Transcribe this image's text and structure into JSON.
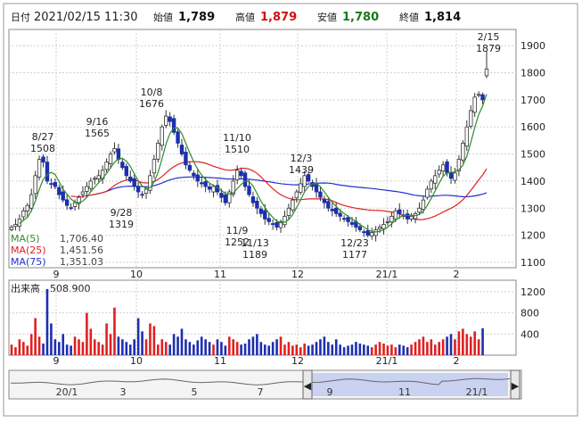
{
  "header": {
    "period_label": "日付",
    "datetime": "2021/02/15 11:30",
    "open_label": "始値",
    "open_value": "1,789",
    "high_label": "高値",
    "high_value": "1,879",
    "low_label": "安値",
    "low_value": "1,780",
    "close_label": "終値",
    "close_value": "1,814"
  },
  "legend": [
    {
      "label": "MA(5)",
      "value": "1,706.40",
      "color": "#2e8b2e"
    },
    {
      "label": "MA(25)",
      "value": "1,451.56",
      "color": "#e02020"
    },
    {
      "label": "MA(75)",
      "value": "1,351.03",
      "color": "#2030d0"
    }
  ],
  "volume_header": {
    "label": "出来高",
    "value": "508.900"
  },
  "colors": {
    "up": "#e02020",
    "down": "#1c2fb0",
    "ma5": "#2e8b2e",
    "ma25": "#e02020",
    "ma75": "#2030d0",
    "grid": "#cfcfcf"
  },
  "chart_data": [
    {
      "type": "candlestick",
      "ylim": [
        1080,
        1960
      ],
      "y_ticks": [
        "1100",
        "1200",
        "1300",
        "1400",
        "1500",
        "1600",
        "1700",
        "1800",
        "1900"
      ],
      "x_ticks": [
        "9",
        "10",
        "11",
        "12",
        "21/1",
        "2"
      ],
      "annotations": [
        {
          "date": "8/27",
          "value": "1508"
        },
        {
          "date": "9/16",
          "value": "1565"
        },
        {
          "date": "9/28",
          "value": "1319"
        },
        {
          "date": "10/8",
          "value": "1676"
        },
        {
          "date": "11/10",
          "value": "1510"
        },
        {
          "date": "11/9",
          "value": "1252"
        },
        {
          "date": "11/13",
          "value": "1189"
        },
        {
          "date": "12/3",
          "value": "1439"
        },
        {
          "date": "12/23",
          "value": "1177"
        },
        {
          "date": "2/15",
          "value": "1879"
        }
      ],
      "closes_approx": [
        1230,
        1240,
        1260,
        1290,
        1310,
        1350,
        1420,
        1480,
        1470,
        1400,
        1390,
        1380,
        1350,
        1330,
        1310,
        1300,
        1320,
        1340,
        1360,
        1380,
        1400,
        1410,
        1420,
        1440,
        1470,
        1500,
        1520,
        1480,
        1450,
        1420,
        1400,
        1380,
        1360,
        1350,
        1370,
        1420,
        1480,
        1540,
        1600,
        1640,
        1620,
        1580,
        1540,
        1500,
        1460,
        1440,
        1420,
        1400,
        1390,
        1380,
        1370,
        1380,
        1360,
        1340,
        1320,
        1360,
        1400,
        1440,
        1420,
        1380,
        1350,
        1320,
        1300,
        1280,
        1260,
        1250,
        1240,
        1230,
        1250,
        1270,
        1300,
        1330,
        1360,
        1390,
        1420,
        1400,
        1380,
        1360,
        1340,
        1320,
        1300,
        1290,
        1280,
        1270,
        1260,
        1250,
        1240,
        1230,
        1220,
        1210,
        1200,
        1210,
        1220,
        1230,
        1240,
        1250,
        1270,
        1290,
        1280,
        1270,
        1260,
        1270,
        1280,
        1300,
        1330,
        1370,
        1400,
        1420,
        1440,
        1460,
        1430,
        1410,
        1430,
        1480,
        1540,
        1600,
        1660,
        1710,
        1720,
        1700,
        1814
      ]
    },
    {
      "type": "bar",
      "title": "出来高",
      "y_ticks": [
        "400",
        "800",
        "1200"
      ],
      "ylim": [
        0,
        1350
      ],
      "x_ticks": [
        "9",
        "10",
        "11",
        "12",
        "21/1",
        "2"
      ],
      "values_approx": [
        200,
        150,
        300,
        250,
        180,
        400,
        700,
        350,
        220,
        1250,
        600,
        300,
        250,
        400,
        200,
        180,
        350,
        300,
        250,
        800,
        500,
        300,
        250,
        200,
        600,
        400,
        900,
        350,
        300,
        250,
        200,
        300,
        700,
        450,
        300,
        600,
        550,
        200,
        300,
        250,
        200,
        400,
        350,
        500,
        300,
        250,
        200,
        280,
        350,
        300,
        250,
        200,
        300,
        250,
        180,
        350,
        300,
        250,
        200,
        220,
        300,
        350,
        400,
        250,
        200,
        180,
        250,
        300,
        350,
        200,
        250,
        180,
        200,
        150,
        220,
        180,
        200,
        250,
        300,
        350,
        250,
        200,
        300,
        200,
        150,
        180,
        200,
        250,
        220,
        200,
        180,
        150,
        200,
        250,
        220,
        180,
        200,
        150,
        200,
        180,
        150,
        200,
        250,
        300,
        350,
        250,
        300,
        200,
        250,
        300,
        350,
        400,
        300,
        450,
        500,
        400,
        350,
        450,
        300,
        509
      ]
    }
  ],
  "navigator": {
    "labels": [
      "20/1",
      "3",
      "5",
      "7",
      "9",
      "11",
      "21/1"
    ]
  }
}
